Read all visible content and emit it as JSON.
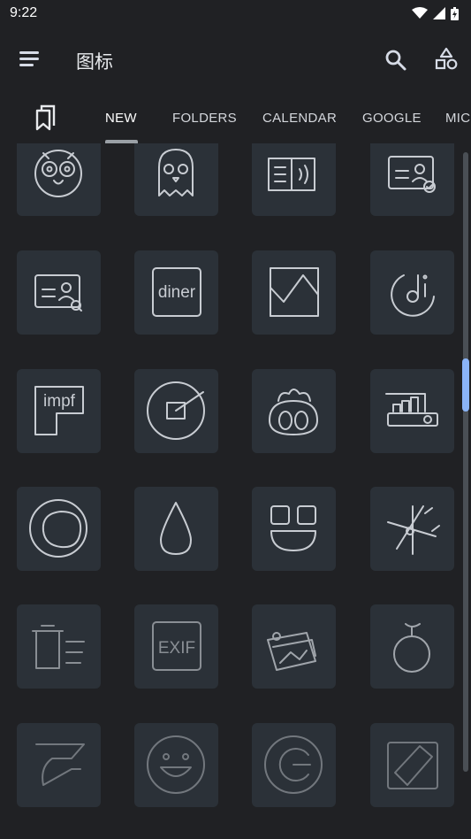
{
  "status_bar": {
    "time": "9:22"
  },
  "app_bar": {
    "title": "图标"
  },
  "tabs": [
    {
      "label": "NEW",
      "active": true
    },
    {
      "label": "FOLDERS",
      "active": false
    },
    {
      "label": "CALENDAR",
      "active": false
    },
    {
      "label": "GOOGLE",
      "active": false
    },
    {
      "label": "MIC",
      "active": false
    }
  ],
  "icons": [
    {
      "name": "owl-face-icon"
    },
    {
      "name": "ghost-icon"
    },
    {
      "name": "audiobook-icon"
    },
    {
      "name": "verified-id-card-icon"
    },
    {
      "name": "id-card-search-icon",
      "text": ""
    },
    {
      "name": "diner-icon",
      "text": "diner"
    },
    {
      "name": "frame-icon"
    },
    {
      "name": "dji-icon"
    },
    {
      "name": "impf-icon",
      "text": "impf"
    },
    {
      "name": "camera-target-icon"
    },
    {
      "name": "sushi-icon"
    },
    {
      "name": "projector-icon"
    },
    {
      "name": "blob-icon"
    },
    {
      "name": "drop-icon"
    },
    {
      "name": "blocks-icon"
    },
    {
      "name": "molecule-icon"
    },
    {
      "name": "trash-list-icon"
    },
    {
      "name": "exif-icon",
      "text": "EXIF"
    },
    {
      "name": "photo-map-icon"
    },
    {
      "name": "apple-icon"
    },
    {
      "name": "swipe-logo-icon"
    },
    {
      "name": "smile-icon"
    },
    {
      "name": "g-logo-icon"
    },
    {
      "name": "docs-badge-icon"
    }
  ],
  "colors": {
    "background": "#202124",
    "tile": "#2b3138",
    "accent": "#8ab4f8"
  }
}
